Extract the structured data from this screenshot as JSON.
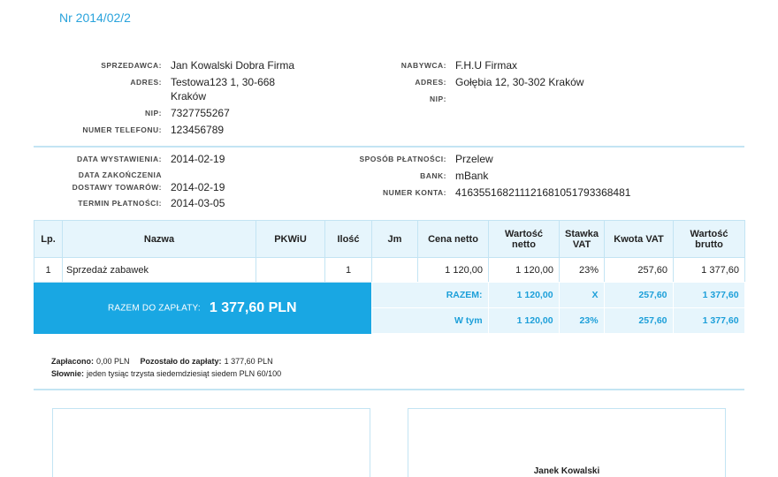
{
  "colors": {
    "accent": "#29a3dc",
    "total_box": "#19a7e3",
    "pale_fill": "#e6f5fc",
    "line": "#c3e4f3",
    "summary_text": "#1c9fd9"
  },
  "invoice": {
    "number": "Nr 2014/02/2"
  },
  "seller": {
    "label": "SPRZEDAWCA:",
    "name": "Jan Kowalski Dobra Firma",
    "address_label": "ADRES:",
    "address_line1": "Testowa123 1, 30-668",
    "address_line2": "Kraków",
    "nip_label": "NIP:",
    "nip": "7327755267",
    "phone_label": "NUMER TELEFONU:",
    "phone": "123456789"
  },
  "buyer": {
    "label": "NABYWCA:",
    "name": "F.H.U Firmax",
    "address_label": "ADRES:",
    "address": "Gołębia 12, 30-302 Kraków",
    "nip_label": "NIP:"
  },
  "dates": {
    "issue_label": "DATA WYSTAWIENIA:",
    "issue": "2014-02-19",
    "delivery_label_line1": "DATA ZAKOŃCZENIA",
    "delivery_label_line2": "DOSTAWY TOWARÓW:",
    "delivery": "2014-02-19",
    "due_label": "TERMIN PŁATNOŚCI:",
    "due": "2014-03-05"
  },
  "payment": {
    "method_label": "SPOSÓB PŁATNOŚCI:",
    "method": "Przelew",
    "bank_label": "BANK:",
    "bank": "mBank",
    "account_label": "NUMER KONTA:",
    "account": "416355168211121681051793368481"
  },
  "table": {
    "headers": [
      "Lp.",
      "Nazwa",
      "PKWiU",
      "Ilość",
      "Jm",
      "Cena netto",
      "Wartość\nnetto",
      "Stawka\nVAT",
      "Kwota VAT",
      "Wartość\nbrutto"
    ],
    "rows": [
      [
        "1",
        "Sprzedaż zabawek",
        "",
        "1",
        "",
        "1 120,00",
        "1 120,00",
        "23%",
        "257,60",
        "1 377,60"
      ]
    ]
  },
  "summary": {
    "total_label": "RAZEM DO ZAPŁATY:",
    "total_amount": "1 377,60 PLN",
    "rows": [
      {
        "label": "RAZEM:",
        "net": "1 120,00",
        "vat_rate": "X",
        "vat": "257,60",
        "gross": "1 377,60"
      },
      {
        "label": "W tym",
        "net": "1 120,00",
        "vat_rate": "23%",
        "vat": "257,60",
        "gross": "1 377,60"
      }
    ]
  },
  "payment_status": {
    "paid_label": "Zapłacono:",
    "paid": "0,00 PLN",
    "remaining_label": "Pozostało do zapłaty:",
    "remaining": "1 377,60 PLN",
    "in_words_label": "Słownie:",
    "in_words": "jeden tysiąc trzysta siedemdziesiąt siedem PLN 60/100"
  },
  "signatures": {
    "issuer_name": "Janek Kowalski"
  }
}
